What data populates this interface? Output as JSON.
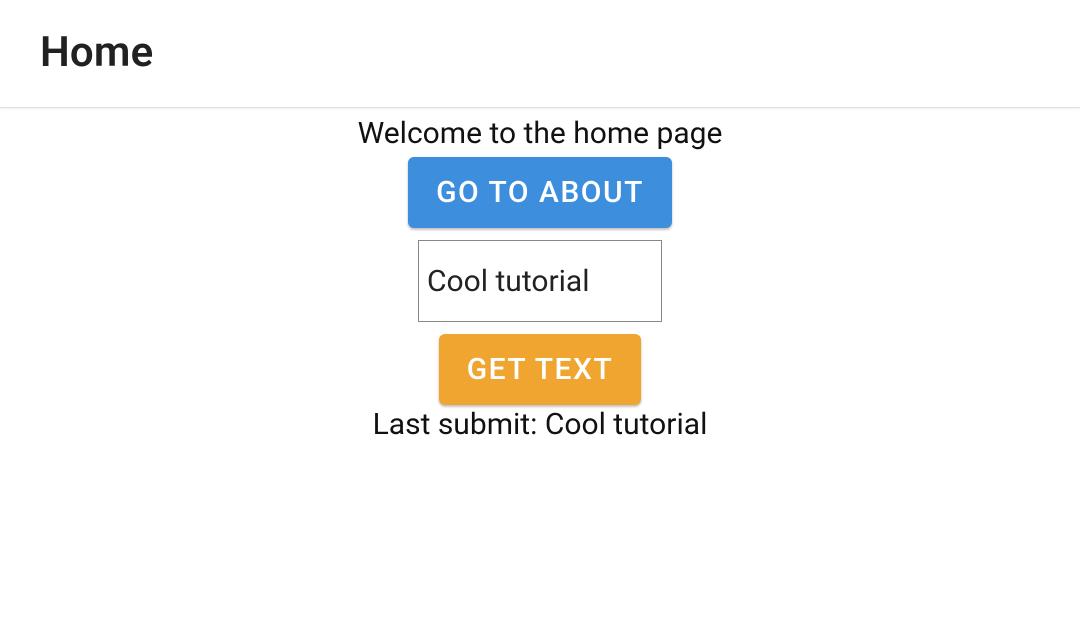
{
  "header": {
    "title": "Home"
  },
  "main": {
    "welcome_text": "Welcome to the home page",
    "go_to_about_label": "GO TO ABOUT",
    "text_input_value": "Cool tutorial",
    "get_text_label": "GET TEXT",
    "last_submit_prefix": "Last submit: ",
    "last_submit_value": "Cool tutorial"
  }
}
